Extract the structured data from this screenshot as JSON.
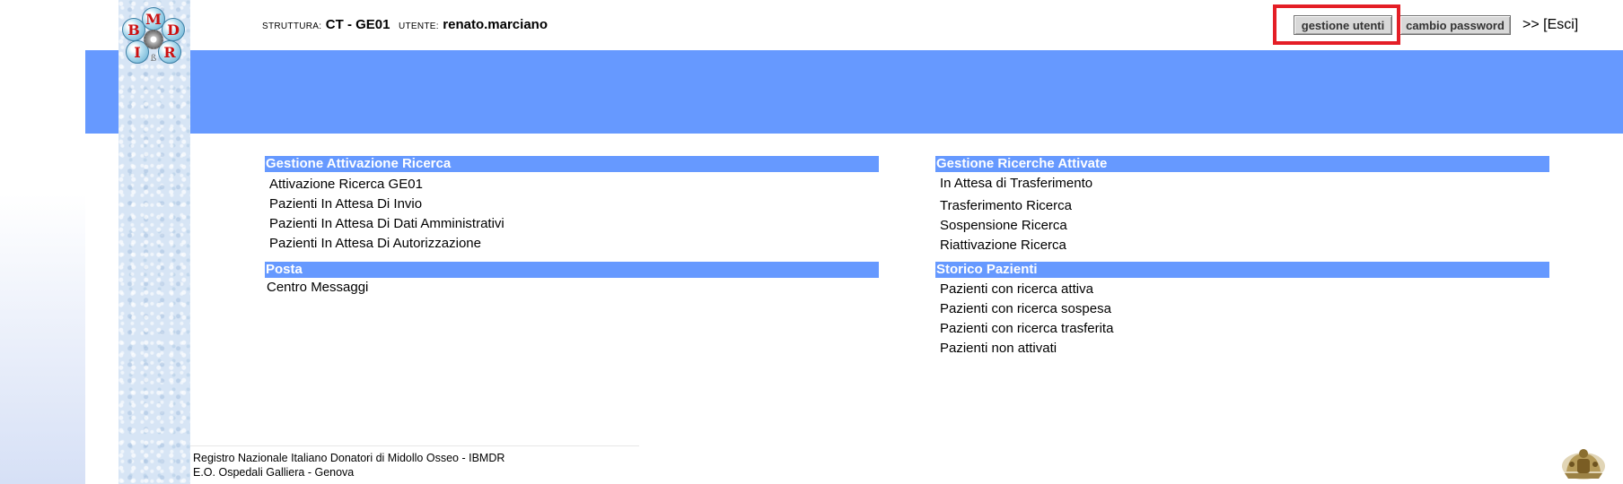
{
  "logo": {
    "letters": [
      "B",
      "M",
      "D",
      "I",
      "R"
    ],
    "gear_icon": "gear-icon",
    "small_text": "ß"
  },
  "header": {
    "struttura_label": "STRUTTURA:",
    "struttura_value": "CT - GE01",
    "utente_label": "UTENTE:",
    "utente_value": "renato.marciano",
    "buttons": {
      "gestione_utenti": "gestione utenti",
      "cambio_password": "cambio password"
    },
    "logout_label": ">> [Esci]"
  },
  "sections": {
    "gestione_attivazione": {
      "title": "Gestione Attivazione Ricerca",
      "items": [
        "Attivazione Ricerca GE01",
        "Pazienti In Attesa Di Invio",
        "Pazienti In Attesa Di Dati Amministrativi",
        "Pazienti In Attesa Di Autorizzazione"
      ]
    },
    "posta": {
      "title": "Posta",
      "items": [
        "Centro Messaggi"
      ]
    },
    "gestione_ricerche": {
      "title": "Gestione Ricerche Attivate",
      "items": [
        "In Attesa di Trasferimento",
        "Trasferimento Ricerca",
        "Sospensione Ricerca",
        "Riattivazione Ricerca"
      ]
    },
    "storico": {
      "title": "Storico Pazienti",
      "items": [
        "Pazienti con ricerca attiva",
        "Pazienti con ricerca sospesa",
        "Pazienti con ricerca trasferita",
        "Pazienti non attivati"
      ]
    }
  },
  "footer": {
    "line1": "Registro Nazionale Italiano Donatori di Midollo Osseo - IBMDR",
    "line2": "E.O. Ospedali Galliera - Genova",
    "crest_icon": "coat-of-arms-icon"
  },
  "colors": {
    "band": "#6699ff",
    "section_header": "#6699ff",
    "highlight": "#e41e26"
  }
}
